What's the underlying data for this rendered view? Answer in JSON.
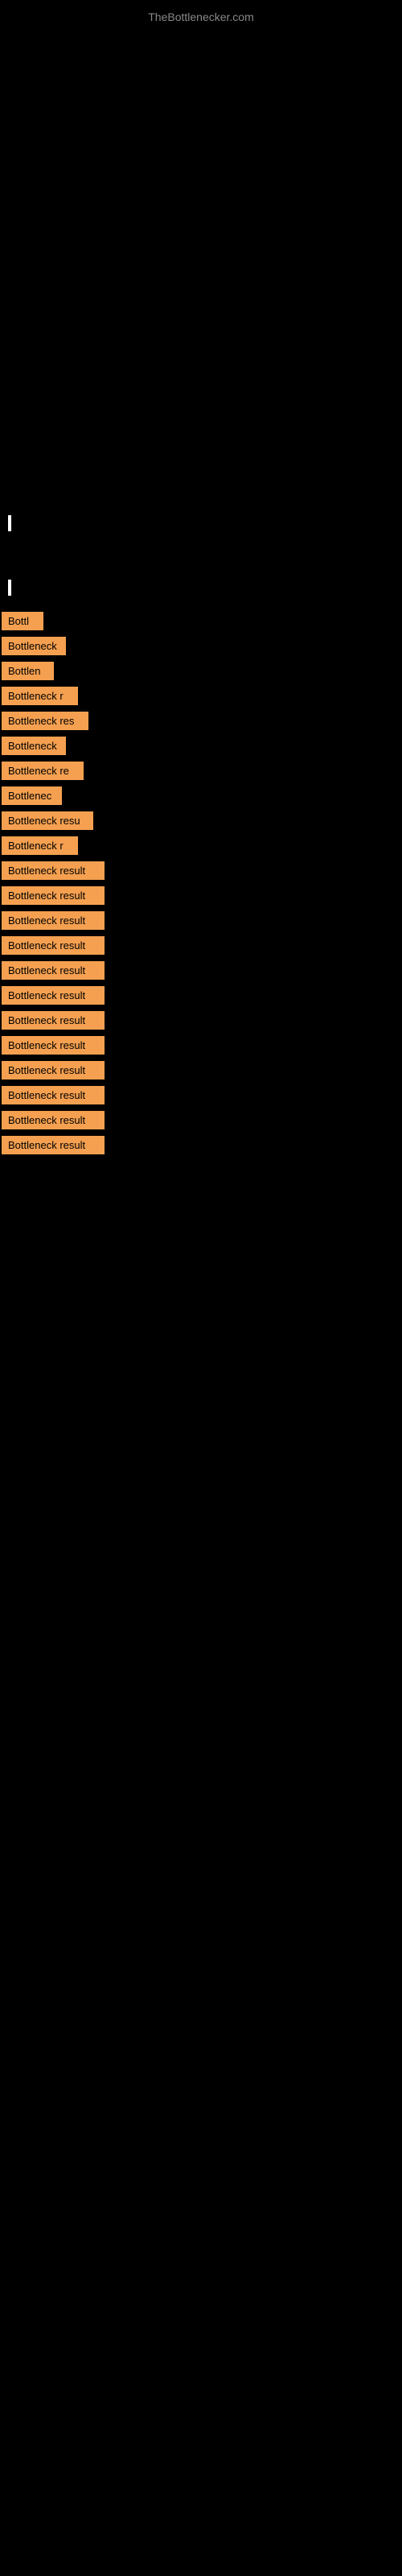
{
  "header": {
    "site_title": "TheBottlenecker.com"
  },
  "bottleneck_items": [
    {
      "id": 1,
      "label": "Bottl",
      "width": 52
    },
    {
      "id": 2,
      "label": "Bottleneck",
      "width": 80
    },
    {
      "id": 3,
      "label": "Bottlen",
      "width": 65
    },
    {
      "id": 4,
      "label": "Bottleneck r",
      "width": 95
    },
    {
      "id": 5,
      "label": "Bottleneck res",
      "width": 108
    },
    {
      "id": 6,
      "label": "Bottleneck",
      "width": 80
    },
    {
      "id": 7,
      "label": "Bottleneck re",
      "width": 102
    },
    {
      "id": 8,
      "label": "Bottlenec",
      "width": 75
    },
    {
      "id": 9,
      "label": "Bottleneck resu",
      "width": 114
    },
    {
      "id": 10,
      "label": "Bottleneck r",
      "width": 95
    },
    {
      "id": 11,
      "label": "Bottleneck result",
      "width": 128
    },
    {
      "id": 12,
      "label": "Bottleneck result",
      "width": 128
    },
    {
      "id": 13,
      "label": "Bottleneck result",
      "width": 128
    },
    {
      "id": 14,
      "label": "Bottleneck result",
      "width": 128
    },
    {
      "id": 15,
      "label": "Bottleneck result",
      "width": 128
    },
    {
      "id": 16,
      "label": "Bottleneck result",
      "width": 128
    },
    {
      "id": 17,
      "label": "Bottleneck result",
      "width": 128
    },
    {
      "id": 18,
      "label": "Bottleneck result",
      "width": 128
    },
    {
      "id": 19,
      "label": "Bottleneck result",
      "width": 128
    },
    {
      "id": 20,
      "label": "Bottleneck result",
      "width": 128
    },
    {
      "id": 21,
      "label": "Bottleneck result",
      "width": 128
    },
    {
      "id": 22,
      "label": "Bottleneck result",
      "width": 128
    }
  ]
}
